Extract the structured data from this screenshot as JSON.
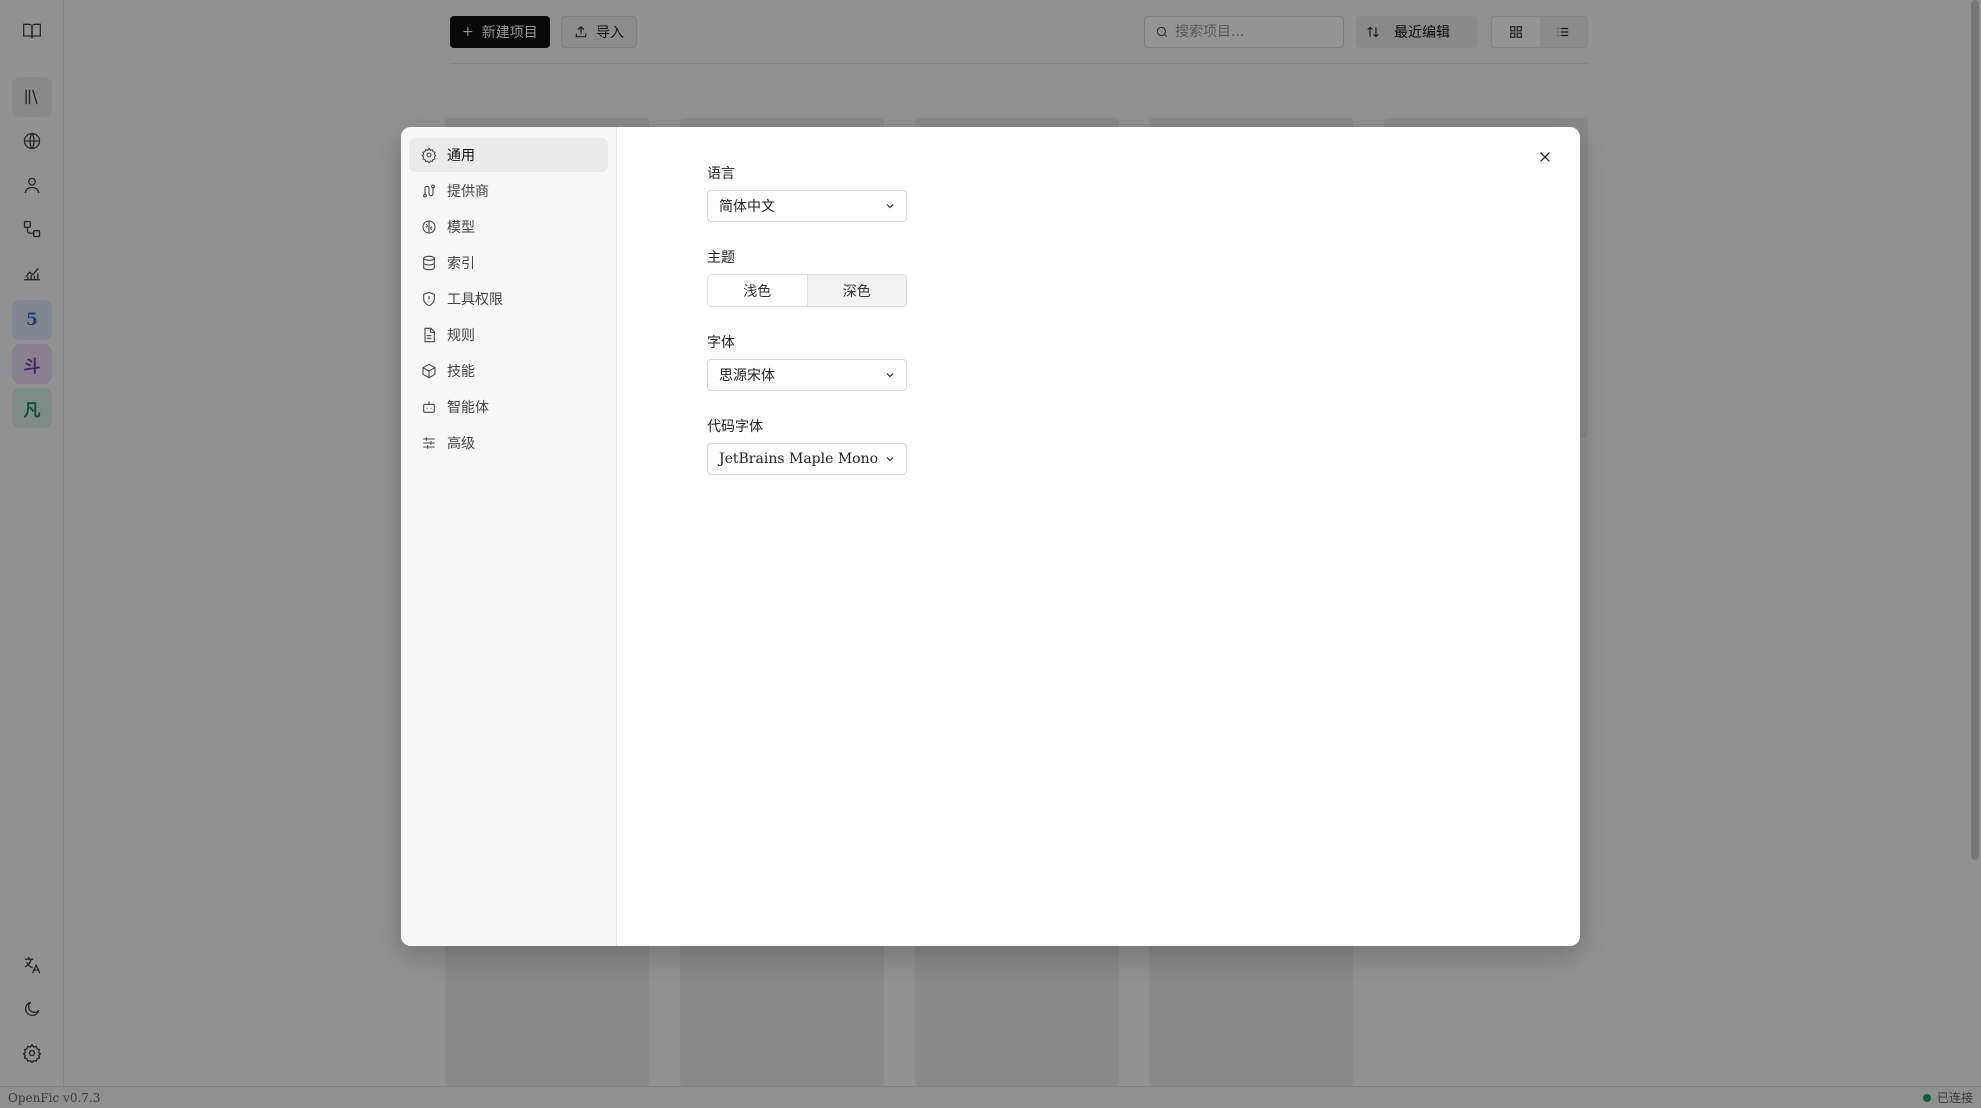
{
  "app": {
    "version": "OpenFic v0.7.3",
    "connection_status": "已连接"
  },
  "rail": {
    "items": [
      {
        "icon": "book-open-icon"
      },
      {
        "icon": "library-icon"
      },
      {
        "icon": "globe-icon"
      },
      {
        "icon": "user-icon"
      },
      {
        "icon": "workflow-icon"
      },
      {
        "icon": "chart-icon"
      }
    ],
    "projects": [
      {
        "label": "5",
        "color": "#2f6fd6",
        "bg": "#dde8f7"
      },
      {
        "label": "斗",
        "color": "#7a3fb0",
        "bg": "#ecdff5"
      },
      {
        "label": "凡",
        "color": "#1c8c6a",
        "bg": "#d9f0e8"
      }
    ]
  },
  "toolbar": {
    "new_project_label": "新建项目",
    "import_label": "导入",
    "search_placeholder": "搜索项目...",
    "sort_label": "最近编辑"
  },
  "settings": {
    "nav": [
      {
        "label": "通用",
        "icon": "gear-icon",
        "active": true
      },
      {
        "label": "提供商",
        "icon": "route-icon"
      },
      {
        "label": "模型",
        "icon": "brain-icon"
      },
      {
        "label": "索引",
        "icon": "database-icon"
      },
      {
        "label": "工具权限",
        "icon": "shield-icon"
      },
      {
        "label": "规则",
        "icon": "document-icon"
      },
      {
        "label": "技能",
        "icon": "package-icon"
      },
      {
        "label": "智能体",
        "icon": "bot-icon"
      },
      {
        "label": "高级",
        "icon": "sliders-icon"
      }
    ],
    "language": {
      "label": "语言",
      "value": "简体中文"
    },
    "theme": {
      "label": "主题",
      "options": [
        "浅色",
        "深色"
      ],
      "selected": "浅色"
    },
    "font": {
      "label": "字体",
      "value": "思源宋体"
    },
    "code_font": {
      "label": "代码字体",
      "value": "JetBrains Maple Mono"
    }
  }
}
